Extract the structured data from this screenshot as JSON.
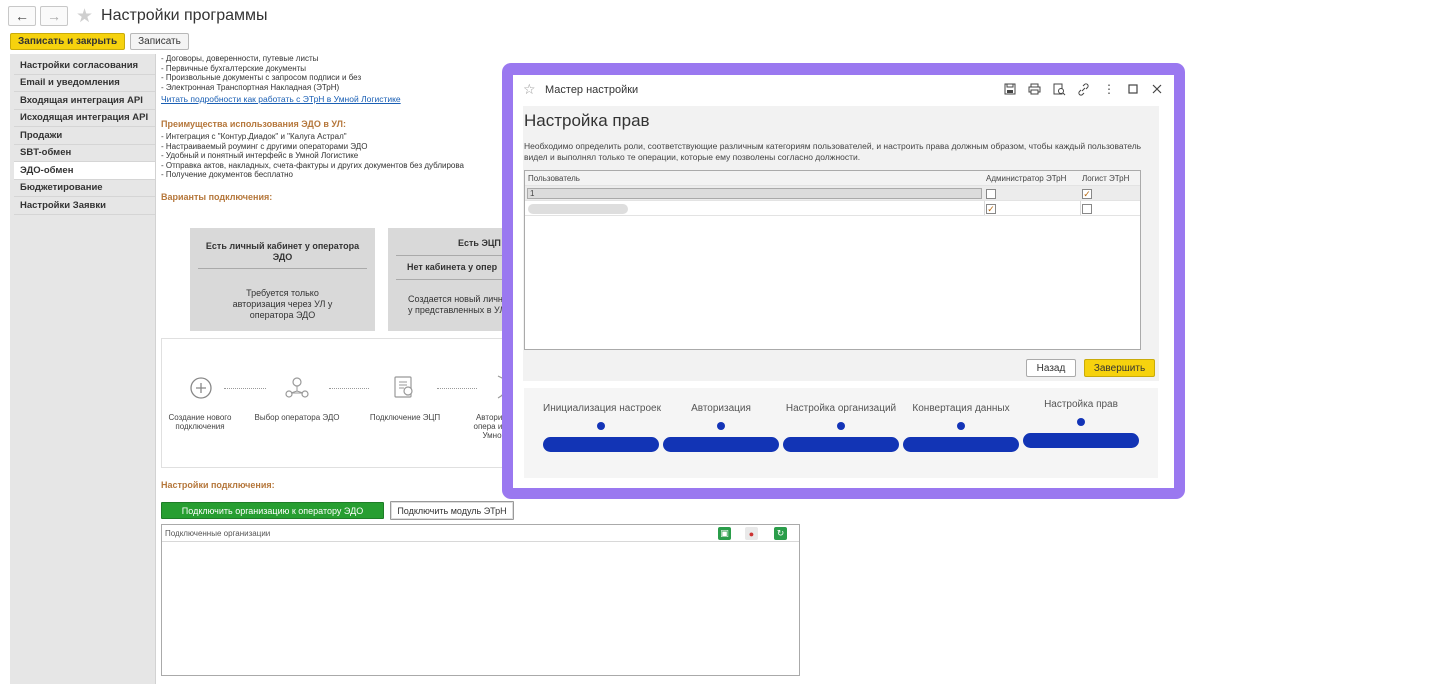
{
  "window": {
    "title": "Настройки программы",
    "back_icon": "arrow-left",
    "forward_icon": "arrow-right"
  },
  "actions": {
    "save_close": "Записать и закрыть",
    "save": "Записать"
  },
  "sidebar": {
    "items": [
      {
        "label": "Настройки согласования",
        "active": false
      },
      {
        "label": "Email и уведомления",
        "active": false
      },
      {
        "label": "Входящая интеграция API",
        "active": false
      },
      {
        "label": "Исходящая интеграция API",
        "active": false
      },
      {
        "label": "Продажи",
        "active": false
      },
      {
        "label": "SBT-обмен",
        "active": false
      },
      {
        "label": "ЭДО-обмен",
        "active": true
      },
      {
        "label": "Бюджетирование",
        "active": false
      },
      {
        "label": "Настройки Заявки",
        "active": false
      }
    ]
  },
  "content": {
    "doc_lines": [
      "- Договоры, доверенности, путевые листы",
      "- Первичные бухгалтерские документы",
      "- Произвольные документы с запросом подписи и без",
      "- Электронная Транспортная Накладная (ЭТрН)"
    ],
    "link": "Читать подробности как работать с ЭТрН в Умной Логистике",
    "advantages_title": "Преимущества использования ЭДО в УЛ:",
    "advantages": [
      "- Интеграция с \"Контур.Диадок\" и \"Калуга Астрал\"",
      "- Настраиваемый роуминг с другими операторами ЭДО",
      "- Удобный и понятный интерфейс в Умной Логистике",
      "- Отправка актов, накладных, счета-фактуры и других документов без дублирова",
      "- Получение документов бесплатно"
    ],
    "variants_title": "Варианты подключения:",
    "card1": {
      "title": "Есть личный кабинет у оператора ЭДО",
      "body": "Требуется только авторизация через УЛ у оператора ЭДО"
    },
    "card2": {
      "title_top": "Есть ЭЦП",
      "title": "Нет кабинета у опер",
      "body": "Создается новый личн у представленных в УЛ"
    },
    "steps": [
      {
        "label": "Создание нового подключения",
        "icon": "plus-circle-icon"
      },
      {
        "label": "Выбор оператора ЭДО",
        "icon": "network-icon"
      },
      {
        "label": "Подключение ЭЦП",
        "icon": "certificate-icon"
      },
      {
        "label": "Авториз опера из Умной",
        "icon": "shield-icon"
      }
    ],
    "settings_title": "Настройки подключения:",
    "connect_operator_btn": "Подключить организацию к оператору ЭДО",
    "connect_module_btn": "Подключить модуль ЭТрН",
    "orgs_header": "Подключенные организации"
  },
  "dialog": {
    "title": "Мастер настройки",
    "heading": "Настройка прав",
    "description": "Необходимо определить роли, соответствующие различным категориям пользователей, и настроить права должным образом, чтобы каждый пользователь видел и выполнял только те операции, которые ему позволены согласно должности.",
    "columns": [
      "Пользователь",
      "Администратор ЭТрН",
      "Логист ЭТрН"
    ],
    "rows": [
      {
        "user": "1",
        "admin": false,
        "logist": true,
        "selected": true
      },
      {
        "user": "",
        "admin": true,
        "logist": false,
        "selected": false
      }
    ],
    "back_btn": "Назад",
    "finish_btn": "Завершить",
    "steps": [
      "Инициализация настроек",
      "Авторизация",
      "Настройка организаций",
      "Конвертация данных",
      "Настройка прав"
    ],
    "accent": "#9a78f0",
    "step_color": "#1234b5"
  }
}
